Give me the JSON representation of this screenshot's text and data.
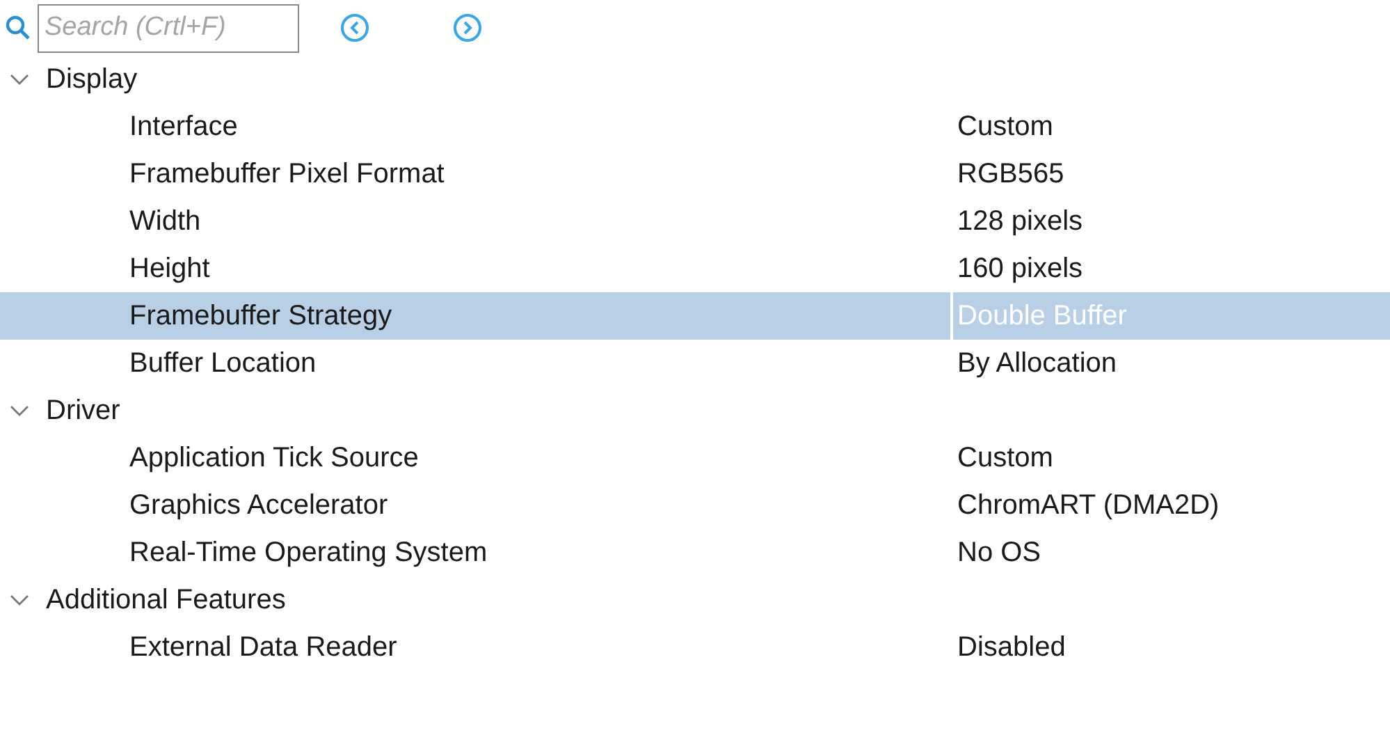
{
  "search": {
    "placeholder": "Search (Crtl+F)"
  },
  "groups": [
    {
      "label": "Display",
      "expanded": true,
      "children": [
        {
          "label": "Interface",
          "value": "Custom",
          "selected": false
        },
        {
          "label": "Framebuffer Pixel Format",
          "value": "RGB565",
          "selected": false
        },
        {
          "label": "Width",
          "value": "128 pixels",
          "selected": false
        },
        {
          "label": "Height",
          "value": "160 pixels",
          "selected": false
        },
        {
          "label": "Framebuffer Strategy",
          "value": "Double Buffer",
          "selected": true
        },
        {
          "label": "Buffer Location",
          "value": "By Allocation",
          "selected": false
        }
      ]
    },
    {
      "label": "Driver",
      "expanded": true,
      "children": [
        {
          "label": "Application Tick Source",
          "value": "Custom",
          "selected": false
        },
        {
          "label": "Graphics Accelerator",
          "value": "ChromART (DMA2D)",
          "selected": false
        },
        {
          "label": "Real-Time Operating System",
          "value": "No OS",
          "selected": false
        }
      ]
    },
    {
      "label": "Additional Features",
      "expanded": true,
      "children": [
        {
          "label": "External Data Reader",
          "value": "Disabled",
          "selected": false
        }
      ]
    }
  ]
}
